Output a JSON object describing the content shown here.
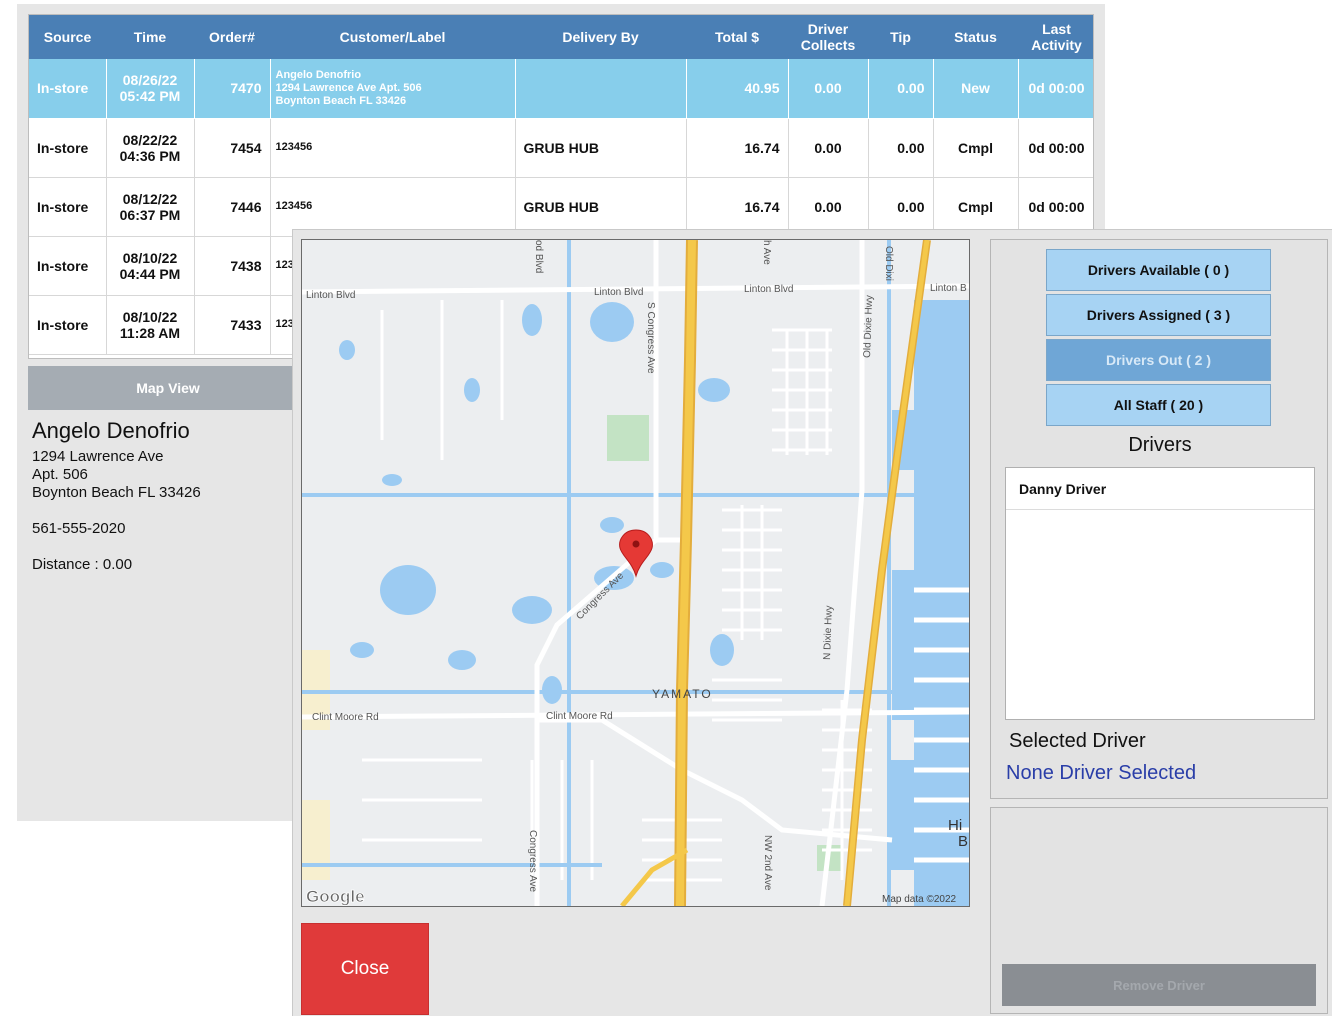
{
  "orders": {
    "columns": [
      "Source",
      "Time",
      "Order#",
      "Customer/Label",
      "Delivery By",
      "Total $",
      "Driver Collects",
      "Tip",
      "Status",
      "Last Activity"
    ],
    "rows": [
      {
        "source": "In-store",
        "date": "08/26/22",
        "time": "05:42 PM",
        "order": "7470",
        "customer_lines": [
          "Angelo Denofrio",
          "1294 Lawrence Ave Apt. 506",
          "Boynton Beach FL 33426"
        ],
        "delivery_by": "",
        "total": "40.95",
        "driver_collects": "0.00",
        "tip": "0.00",
        "status": "New",
        "last_activity": "0d 00:00",
        "selected": true
      },
      {
        "source": "In-store",
        "date": "08/22/22",
        "time": "04:36 PM",
        "order": "7454",
        "customer_lines": [
          "123456"
        ],
        "delivery_by": "GRUB HUB",
        "total": "16.74",
        "driver_collects": "0.00",
        "tip": "0.00",
        "status": "Cmpl",
        "last_activity": "0d 00:00"
      },
      {
        "source": "In-store",
        "date": "08/12/22",
        "time": "06:37 PM",
        "order": "7446",
        "customer_lines": [
          "123456"
        ],
        "delivery_by": "GRUB HUB",
        "total": "16.74",
        "driver_collects": "0.00",
        "tip": "0.00",
        "status": "Cmpl",
        "last_activity": "0d 00:00"
      },
      {
        "source": "In-store",
        "date": "08/10/22",
        "time": "04:44 PM",
        "order": "7438",
        "customer_lines": [
          "123"
        ],
        "delivery_by": "",
        "total": "",
        "driver_collects": "",
        "tip": "",
        "status": "",
        "last_activity": ""
      },
      {
        "source": "In-store",
        "date": "08/10/22",
        "time": "11:28 AM",
        "order": "7433",
        "customer_lines": [
          "123"
        ],
        "delivery_by": "",
        "total": "",
        "driver_collects": "",
        "tip": "",
        "status": "",
        "last_activity": ""
      }
    ]
  },
  "map_view": {
    "label": "Map View"
  },
  "customer": {
    "name": "Angelo Denofrio",
    "street": "1294 Lawrence Ave",
    "apt": "Apt. 506",
    "city": "Boynton Beach FL 33426",
    "phone": "561-555-2020",
    "distance": "Distance : 0.00"
  },
  "map": {
    "labels": {
      "linton1": "Linton Blvd",
      "linton2": "Linton Blvd",
      "linton3": "Linton Blvd",
      "linton4": "Linton B",
      "congress_n": "S Congress Ave",
      "congress_mid": "Congress Ave",
      "congress_s": "Congress Ave",
      "old_dixie": "Old Dixie Hwy",
      "old_dixie_top": "Old Dixi",
      "n_dixie": "N Dixie Hwy",
      "clint1": "Clint Moore Rd",
      "clint2": "Clint Moore Rd",
      "yamato": "YAMATO",
      "nw2": "NW 2nd Ave",
      "hi": "Hi",
      "b": "B",
      "od_blvd": "od Blvd",
      "h_ave": "h Ave",
      "google": "Google",
      "attribution": "Map data ©2022"
    }
  },
  "dialog": {
    "close_label": "Close",
    "filters": {
      "available": "Drivers Available ( 0 )",
      "assigned": "Drivers Assigned ( 3 )",
      "out": "Drivers Out ( 2 )",
      "all": "All Staff ( 20 )"
    },
    "drivers_title": "Drivers",
    "drivers": [
      "Danny Driver"
    ],
    "selected_label": "Selected Driver",
    "selected_value": "None Driver Selected",
    "remove_label": "Remove Driver"
  },
  "colors": {
    "header_blue": "#4a7fb5",
    "selected_row": "#87ceeb",
    "driver_btn": "#a7d3f3",
    "driver_btn_active": "#6fa6d6",
    "close_red": "#e03a3a",
    "selected_text": "#2a3ea8",
    "highway_yellow": "#f4c84a",
    "water_blue": "#9ccbf2",
    "pin_red": "#e53935"
  }
}
